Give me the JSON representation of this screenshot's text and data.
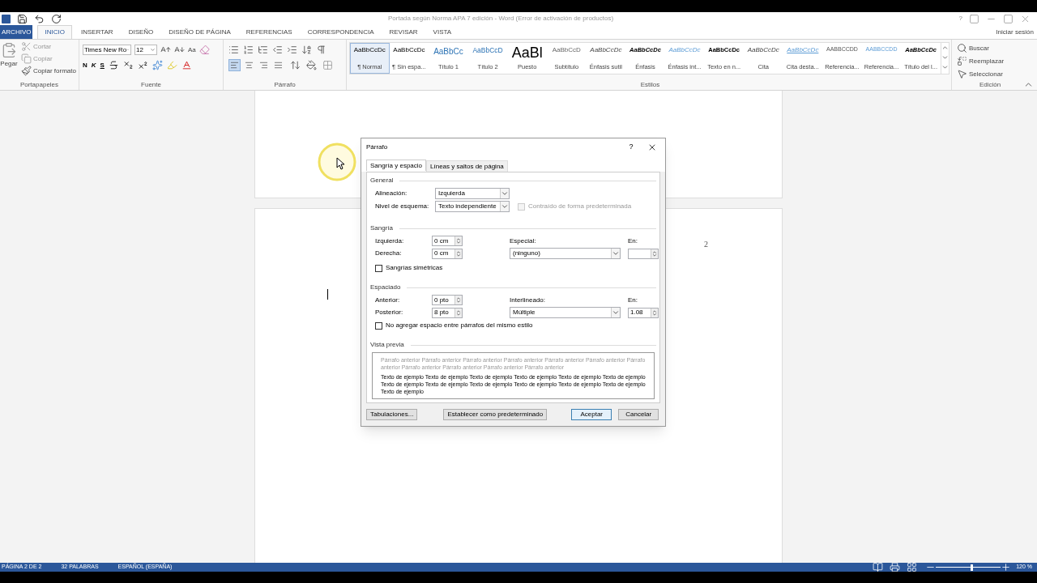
{
  "title_bar": {
    "title": "Portada según Norma APA 7 edición - Word (Error de activación de productos)",
    "help": "?"
  },
  "ribbon_tabs": [
    {
      "label": "ARCHIVO",
      "kind": "file",
      "selected": false
    },
    {
      "label": "INICIO",
      "kind": "tab",
      "selected": true
    },
    {
      "label": "INSERTAR",
      "kind": "tab",
      "selected": false
    },
    {
      "label": "DISEÑO",
      "kind": "tab",
      "selected": false
    },
    {
      "label": "DISEÑO DE PÁGINA",
      "kind": "tab",
      "selected": false
    },
    {
      "label": "REFERENCIAS",
      "kind": "tab",
      "selected": false
    },
    {
      "label": "CORRESPONDENCIA",
      "kind": "tab",
      "selected": false
    },
    {
      "label": "REVISAR",
      "kind": "tab",
      "selected": false
    },
    {
      "label": "VISTA",
      "kind": "tab",
      "selected": false
    }
  ],
  "sign_in": "Iniciar sesión",
  "clipboard": {
    "paste": "Pegar",
    "cut": "Cortar",
    "copy": "Copiar",
    "format_painter": "Copiar formato",
    "group": "Portapapeles"
  },
  "font": {
    "name": "Times New Ro",
    "size": "12",
    "change_case": "Aa",
    "bold": "N",
    "italic": "K",
    "underline": "S",
    "group": "Fuente"
  },
  "paragraph": {
    "group": "Párrafo",
    "align_buttons": [
      {
        "kind": "left",
        "selected": true
      },
      {
        "kind": "center",
        "selected": false
      },
      {
        "kind": "right",
        "selected": false
      },
      {
        "kind": "justify",
        "selected": false
      }
    ]
  },
  "styles": {
    "group": "Estilos",
    "items": [
      {
        "sample": "AaBbCcDc",
        "label": "¶ Normal",
        "kind": "normal",
        "selected": true
      },
      {
        "sample": "AaBbCcDc",
        "label": "¶ Sin espa...",
        "kind": "normal",
        "selected": false
      },
      {
        "sample": "AaBbCc",
        "label": "Título 1",
        "kind": "heading1",
        "selected": false
      },
      {
        "sample": "AaBbCcD",
        "label": "Título 2",
        "kind": "heading2",
        "selected": false
      },
      {
        "sample": "AaBl",
        "label": "Puesto",
        "kind": "title",
        "selected": false
      },
      {
        "sample": "AaBbCcD",
        "label": "Subtítulo",
        "kind": "subtitle",
        "selected": false
      },
      {
        "sample": "AaBbCcDc",
        "label": "Énfasis sutil",
        "kind": "italic",
        "selected": false
      },
      {
        "sample": "AaBbCcDc",
        "label": "Énfasis",
        "kind": "bolditalic",
        "selected": false
      },
      {
        "sample": "AaBbCcDc",
        "label": "Énfasis int...",
        "kind": "blueitalic",
        "selected": false
      },
      {
        "sample": "AaBbCcDc",
        "label": "Texto en n...",
        "kind": "bold",
        "selected": false
      },
      {
        "sample": "AaBbCcDc",
        "label": "Cita",
        "kind": "italic",
        "selected": false
      },
      {
        "sample": "AaBbCcDc",
        "label": "Cita desta...",
        "kind": "quote",
        "selected": false
      },
      {
        "sample": "AABBCCDD",
        "label": "Referencia...",
        "kind": "caps",
        "selected": false
      },
      {
        "sample": "AABBCCDD",
        "label": "Referencia...",
        "kind": "bluecaps",
        "selected": false
      },
      {
        "sample": "AaBbCcDc",
        "label": "Título del l...",
        "kind": "bolditalic",
        "selected": false
      }
    ]
  },
  "editing": {
    "find": "Buscar",
    "replace": "Reemplazar",
    "select": "Seleccionar",
    "group": "Edición"
  },
  "document": {
    "page_number": "2"
  },
  "dialog": {
    "title": "Párrafo",
    "help": "?",
    "tabs": [
      {
        "label": "Sangría y espacio",
        "selected": true
      },
      {
        "label": "Líneas y saltos de página",
        "selected": false
      }
    ],
    "general": {
      "heading": "General",
      "alignment_label": "Alineación:",
      "alignment": "Izquierda",
      "outline_label": "Nivel de esquema:",
      "outline": "Texto independiente",
      "collapsed_label": "Contraído de forma predeterminada",
      "collapsed_checked": false,
      "collapsed_disabled": true
    },
    "indent": {
      "heading": "Sangría",
      "left_label": "Izquierda:",
      "left": "0 cm",
      "right_label": "Derecha:",
      "right": "0 cm",
      "special_label": "Especial:",
      "special": "(ninguno)",
      "by_label": "En:",
      "mirror_label": "Sangrías simétricas",
      "mirror_checked": false
    },
    "spacing": {
      "heading": "Espaciado",
      "before_label": "Anterior:",
      "before": "0 pto",
      "after_label": "Posterior:",
      "after": "8 pto",
      "line_label": "Interlineado:",
      "line": "Múltiple",
      "at_label": "En:",
      "at": "1.08",
      "no_space_label": "No agregar espacio entre párrafos del mismo estilo",
      "no_space_checked": false
    },
    "preview": {
      "heading": "Vista previa",
      "previous": "Párrafo anterior Párrafo anterior Párrafo anterior Párrafo anterior Párrafo anterior Párrafo anterior Párrafo anterior Párrafo anterior Párrafo anterior Párrafo anterior Párrafo anterior",
      "sample": "Texto de ejemplo Texto de ejemplo Texto de ejemplo Texto de ejemplo Texto de ejemplo Texto de ejemplo Texto de ejemplo Texto de ejemplo Texto de ejemplo Texto de ejemplo Texto de ejemplo Texto de ejemplo Texto de ejemplo"
    },
    "buttons": [
      {
        "label": "Tabulaciones...",
        "kind": "normal"
      },
      {
        "label": "Establecer como predeterminado",
        "kind": "normal"
      },
      {
        "label": "Aceptar",
        "kind": "default"
      },
      {
        "label": "Cancelar",
        "kind": "normal"
      }
    ]
  },
  "status_bar": {
    "items": [
      "PÁGINA 2 DE 2",
      "32 PALABRAS",
      "ESPAÑOL (ESPAÑA)"
    ],
    "zoom_slider": {
      "level": 0.55
    },
    "zoom": "120 %"
  }
}
